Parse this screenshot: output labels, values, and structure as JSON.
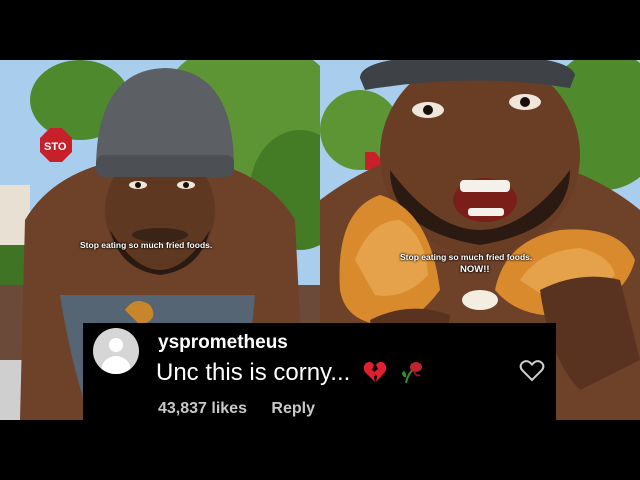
{
  "captions": {
    "left": "Stop eating so much fried foods.",
    "right_line1": "Stop eating so much fried foods.",
    "right_line2": "NOW!!"
  },
  "comment": {
    "username": "ysprometheus",
    "text": "Unc this is corny...",
    "emojis": [
      "broken-heart-icon",
      "wilted-flower-icon"
    ],
    "likes": "43,837 likes",
    "reply_label": "Reply",
    "like_icon": "heart-outline-icon"
  },
  "colors": {
    "sky": "#9fc8ea",
    "foliage": "#4f8a2c",
    "skin": "#7a4a30",
    "beanie": "#5c5f63",
    "fried_chicken": "#d98a2c",
    "stop_sign": "#c8202a"
  }
}
